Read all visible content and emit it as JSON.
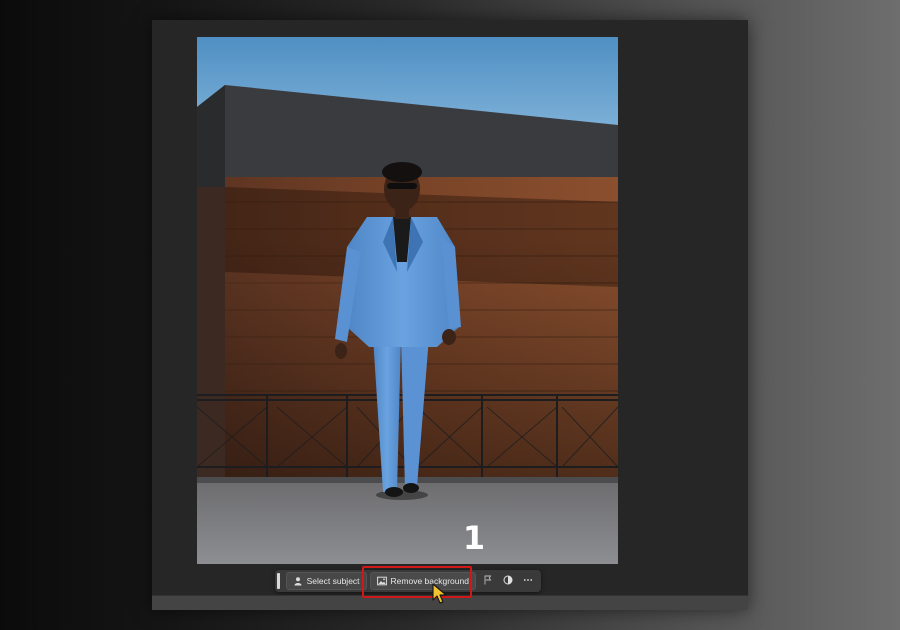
{
  "photo": {
    "subject": "man-in-blue-suit-photo"
  },
  "taskbar": {
    "select_subject_label": "Select subject",
    "remove_background_label": "Remove background",
    "icons": [
      "person-select-icon",
      "image-remove-bg-icon",
      "flag-icon",
      "half-circle-adjust-icon",
      "more-icon"
    ]
  },
  "annotation": {
    "step_number": "1",
    "highlight_color": "#d01818"
  },
  "colors": {
    "app_background": "#262626",
    "taskbar_background": "#3a3a3a",
    "sky": "#5d95c2"
  }
}
